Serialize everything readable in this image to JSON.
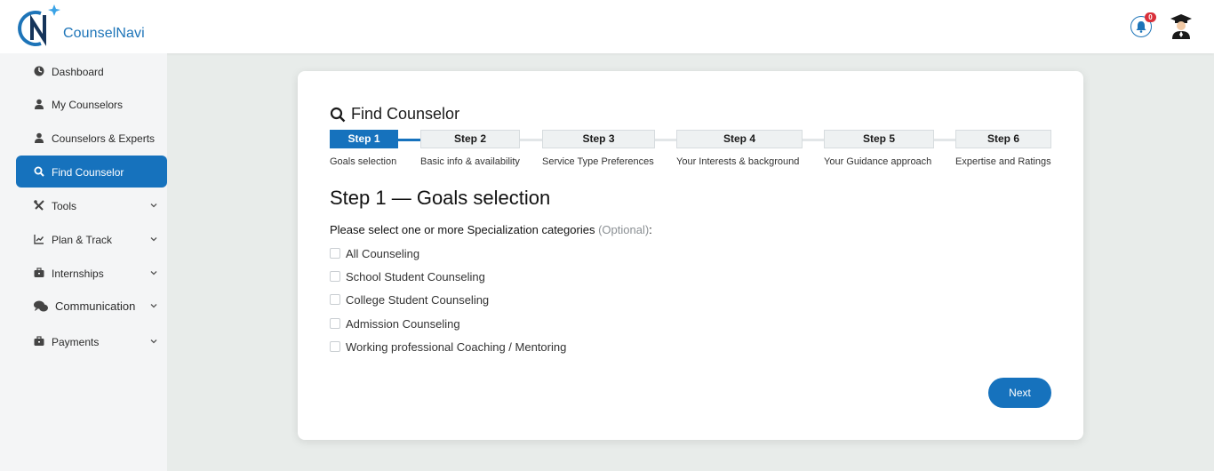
{
  "brand": {
    "name_part1": "Counsel",
    "name_part2": "Navi",
    "color": "#1d74b8"
  },
  "header": {
    "notification_count": "0"
  },
  "sidebar": {
    "items": [
      {
        "label": "Dashboard",
        "icon": "dashboard-icon"
      },
      {
        "label": "My Counselors",
        "icon": "user-icon"
      },
      {
        "label": "Counselors & Experts",
        "icon": "user-icon"
      },
      {
        "label": "Find Counselor",
        "icon": "search-icon",
        "active": true
      },
      {
        "label": "Tools",
        "icon": "tools-icon",
        "expandable": true
      },
      {
        "label": "Plan & Track",
        "icon": "chart-icon",
        "expandable": true
      },
      {
        "label": "Internships",
        "icon": "briefcase-icon",
        "expandable": true
      },
      {
        "label": "Communication",
        "icon": "chat-icon",
        "expandable": true
      },
      {
        "label": "Payments",
        "icon": "briefcase-icon",
        "expandable": true
      }
    ]
  },
  "main": {
    "title": "Find Counselor",
    "steps": [
      {
        "label": "Step 1",
        "caption": "Goals selection",
        "active": true
      },
      {
        "label": "Step 2",
        "caption": "Basic info & availability"
      },
      {
        "label": "Step 3",
        "caption": "Service Type Preferences"
      },
      {
        "label": "Step 4",
        "caption": "Your Interests & background"
      },
      {
        "label": "Step 5",
        "caption": "Your Guidance approach"
      },
      {
        "label": "Step 6",
        "caption": "Expertise and Ratings"
      }
    ],
    "section_title": "Step 1 — Goals selection",
    "prompt": "Please select one or more Specialization categories",
    "prompt_optional": "(Optional)",
    "prompt_suffix": ":",
    "options": [
      "All Counseling",
      "School Student Counseling",
      "College Student Counseling",
      "Admission Counseling",
      "Working professional Coaching / Mentoring"
    ],
    "next_label": "Next"
  },
  "colors": {
    "accent": "#1672bd",
    "badge": "#d9303a",
    "background": "#e8ecea"
  }
}
